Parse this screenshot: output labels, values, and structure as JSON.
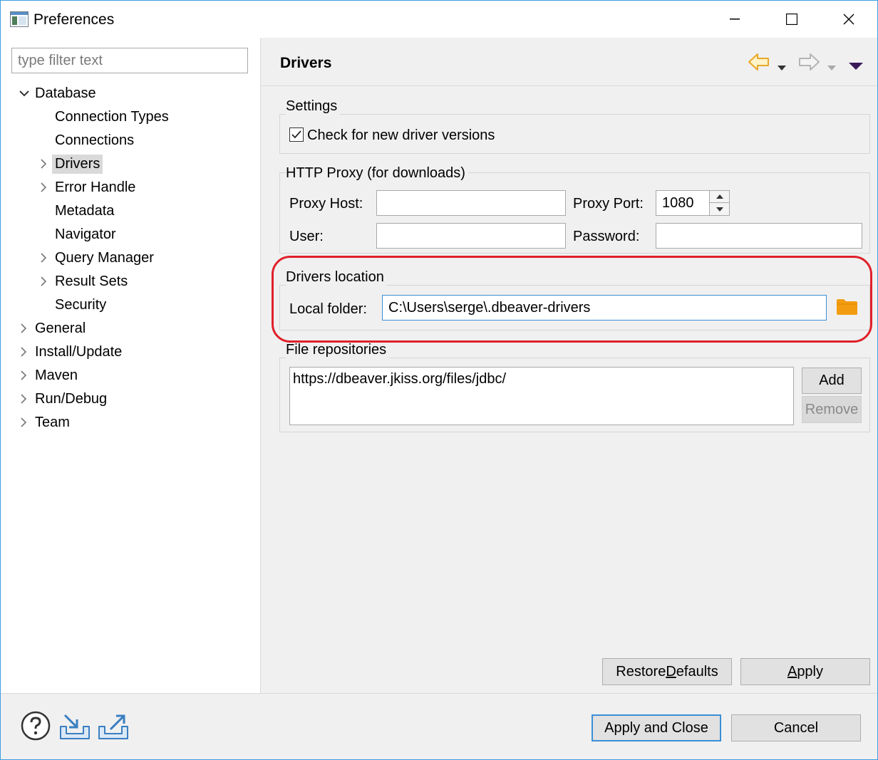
{
  "window": {
    "title": "Preferences",
    "controls": {
      "minimize": "minimize",
      "maximize": "maximize",
      "close": "close"
    }
  },
  "sidebar": {
    "filter_placeholder": "type filter text",
    "tree": [
      {
        "label": "Database",
        "level": 0,
        "expanded": true
      },
      {
        "label": "Connection Types",
        "level": 1
      },
      {
        "label": "Connections",
        "level": 1
      },
      {
        "label": "Drivers",
        "level": 1,
        "expandable": true,
        "selected": true
      },
      {
        "label": "Error Handle",
        "level": 1,
        "expandable": true
      },
      {
        "label": "Metadata",
        "level": 1
      },
      {
        "label": "Navigator",
        "level": 1
      },
      {
        "label": "Query Manager",
        "level": 1,
        "expandable": true
      },
      {
        "label": "Result Sets",
        "level": 1,
        "expandable": true
      },
      {
        "label": "Security",
        "level": 1
      },
      {
        "label": "General",
        "level": 0,
        "expandable": true
      },
      {
        "label": "Install/Update",
        "level": 0,
        "expandable": true
      },
      {
        "label": "Maven",
        "level": 0,
        "expandable": true
      },
      {
        "label": "Run/Debug",
        "level": 0,
        "expandable": true
      },
      {
        "label": "Team",
        "level": 0,
        "expandable": true
      }
    ]
  },
  "page": {
    "title": "Drivers",
    "settings": {
      "title": "Settings",
      "check_versions_label": "Check for new driver versions",
      "check_versions_checked": true
    },
    "proxy": {
      "title": "HTTP Proxy (for downloads)",
      "host_label": "Proxy Host:",
      "host_value": "",
      "port_label": "Proxy Port:",
      "port_value": "1080",
      "user_label": "User:",
      "user_value": "",
      "password_label": "Password:",
      "password_value": ""
    },
    "location": {
      "title": "Drivers location",
      "folder_label": "Local folder:",
      "folder_value": "C:\\Users\\serge\\.dbeaver-drivers"
    },
    "repositories": {
      "title": "File repositories",
      "items": [
        "https://dbeaver.jkiss.org/files/jdbc/"
      ],
      "add_label": "Add",
      "remove_label": "Remove"
    },
    "restore_defaults": {
      "before": "Restore ",
      "mnemonic": "D",
      "after": "efaults"
    },
    "apply": {
      "before": "",
      "mnemonic": "A",
      "after": "pply"
    }
  },
  "footer": {
    "apply_close_label": "Apply and Close",
    "cancel_label": "Cancel"
  },
  "colors": {
    "highlight": "#e0202a",
    "back_arrow": "#e8a82a",
    "folder_icon": "#f39c12",
    "menu_arrow": "#3b1a5c"
  }
}
